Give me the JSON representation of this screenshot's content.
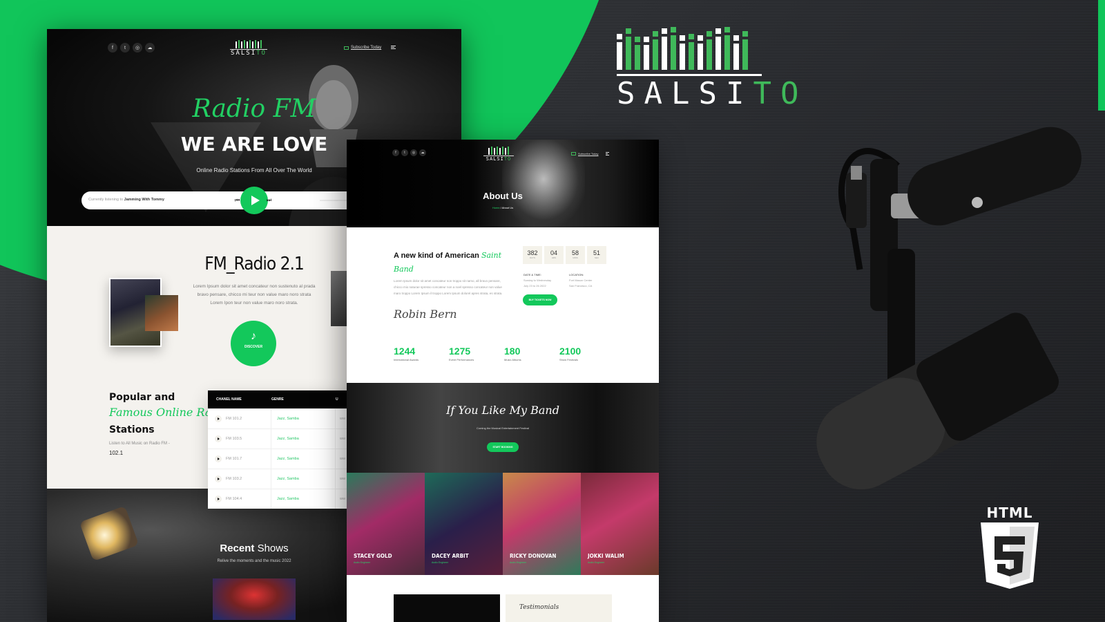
{
  "brand": {
    "name_main": "SALSI",
    "name_accent": "TO",
    "badge": "HTML",
    "badge_number": "5"
  },
  "colors": {
    "accent": "#13c85b",
    "background_green": "#11c55a",
    "background_dark": "#2a2c30"
  },
  "home_page": {
    "nav": {
      "socials": [
        "facebook-icon",
        "twitter-icon",
        "instagram-icon",
        "soundcloud-icon"
      ],
      "social_glyphs": [
        "f",
        "t",
        "◎",
        "☁"
      ],
      "subscribe": "Subscribe Today"
    },
    "hero": {
      "script_title": "Radio FM",
      "title": "WE ARE LOVE",
      "subtitle": "Online Radio Stations From All Over The World"
    },
    "player": {
      "prefix": "Currently listening to",
      "track": "Jamming With Tommy"
    },
    "about": {
      "title": "FM_Radio 2.1",
      "text": "Lorem Ipsum dolor sit amet concateur non sustenuto al prada bravo pensare, chicco mi teur non value maro noro strata Lorem Ipon teur non value maro noro strata.",
      "discover": "DISCOVER"
    },
    "stations": {
      "heading_1": "Popular and",
      "heading_script": "Famous Online Radio",
      "heading_2": "Stations",
      "sub": "Listen to All Music on Radio FM -",
      "frequency": "102.1",
      "columns": [
        "CHANEL NAME",
        "GENRE",
        "U"
      ],
      "rows": [
        {
          "name": "FM 101.2",
          "genre": "Jazz, Samba",
          "extra": "ww"
        },
        {
          "name": "FM 103.5",
          "genre": "Jazz, Samba",
          "extra": "ww"
        },
        {
          "name": "FM 101.7",
          "genre": "Jazz, Samba",
          "extra": "ww"
        },
        {
          "name": "FM 103.2",
          "genre": "Jazz, Samba",
          "extra": "ww"
        },
        {
          "name": "FM 104.4",
          "genre": "Jazz, Samba",
          "extra": "ww"
        }
      ]
    },
    "shows": {
      "title_bold": "Recent",
      "title_rest": " Shows",
      "subtitle": "Relive the moments and the music 2022"
    }
  },
  "about_page": {
    "nav": {
      "subscribe": "Subscribe Today"
    },
    "hero": {
      "title": "About Us",
      "breadcrumb_home": "Home",
      "breadcrumb_sep": " / ",
      "breadcrumb_current": "About Us"
    },
    "intro": {
      "heading": "A new kind of American ",
      "heading_script": "Saint Band",
      "text": "Lorem Ipsum dolor sit amet concateur non troppo sit namo, all bravo pensare, chicco mio naturae spresso concateur non a noel spresso concateur non value maro troppo Lorem Ipsum il troppo Lorem Ipsum dolorel apres strata, es strata.",
      "signature": "Robin Bern"
    },
    "countdown": [
      {
        "value": "382",
        "unit": "DAYS"
      },
      {
        "value": "04",
        "unit": "HRS"
      },
      {
        "value": "58",
        "unit": "MINS"
      },
      {
        "value": "51",
        "unit": "SEC"
      }
    ],
    "event": {
      "date_label": "DATE & TIME:",
      "date_line1": "Sunday to Wednesday",
      "date_line2": "July 23 to 26 2022",
      "location_label": "LOCATION:",
      "location_line1": "Fort Mason Center",
      "location_line2": "San Francisco, CA",
      "cta": "BUY TICKETS NOW"
    },
    "stats": [
      {
        "value": "1244",
        "label": "International Awards"
      },
      {
        "value": "1275",
        "label": "Event Performances"
      },
      {
        "value": "180",
        "label": "Music Albums"
      },
      {
        "value": "2100",
        "label": "Show Festivals"
      }
    ],
    "band": {
      "title": "If You Like My Band",
      "subtitle": "Coming the Musical Entertainment Festival",
      "cta": "START BOOKING"
    },
    "team": [
      {
        "name": "STACEY GOLD",
        "role": "Audio Engineer"
      },
      {
        "name": "DACEY ARBIT",
        "role": "Audio Engineer"
      },
      {
        "name": "RICKY DONOVAN",
        "role": "Audio Engineer"
      },
      {
        "name": "JOKKI WALIM",
        "role": "Audio Engineer"
      }
    ],
    "testimonials_title": "Testimonials"
  }
}
